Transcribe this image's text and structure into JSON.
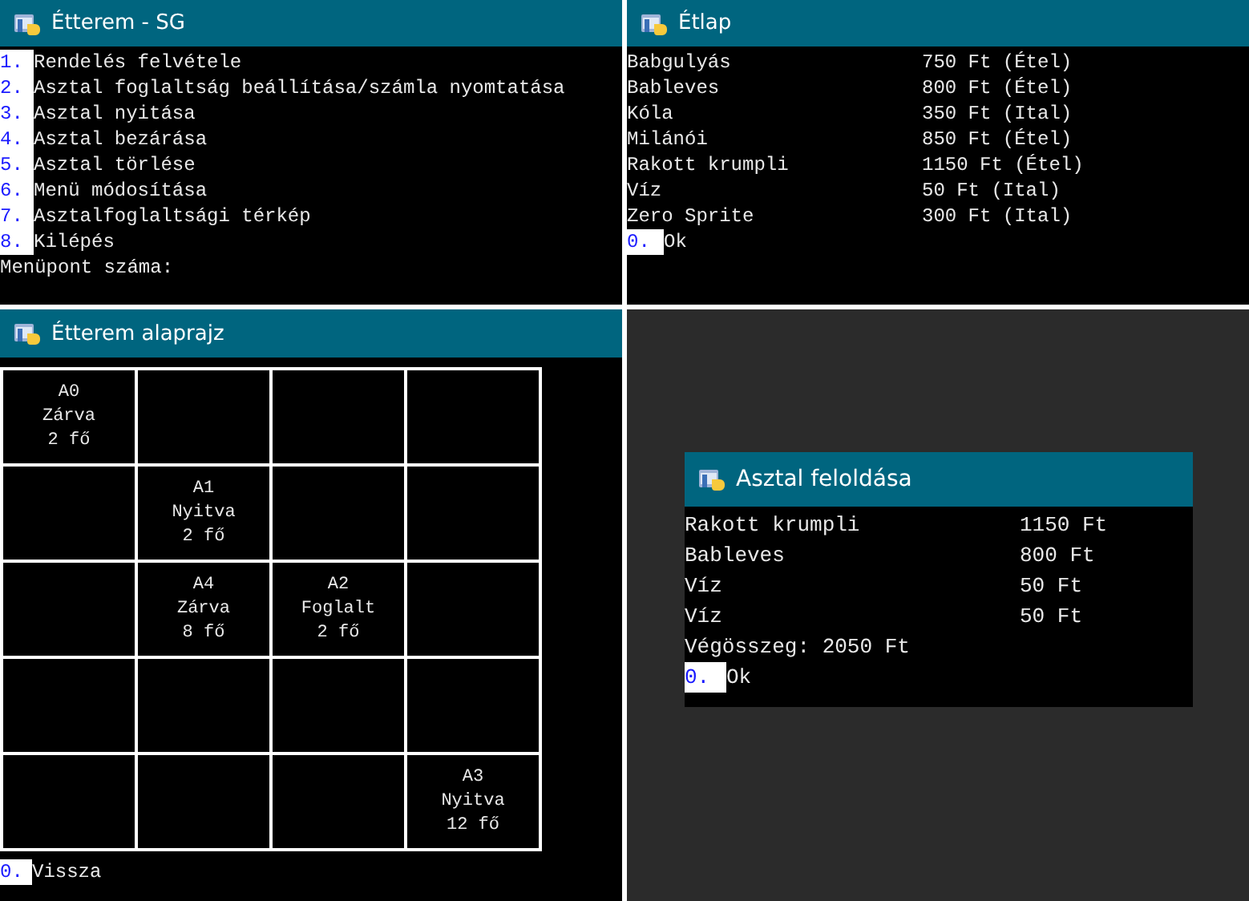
{
  "menu_window": {
    "title": "Étterem - SG",
    "items": [
      {
        "key": "1.",
        "label": "Rendelés felvétele"
      },
      {
        "key": "2.",
        "label": "Asztal foglaltság beállítása/számla nyomtatása"
      },
      {
        "key": "3.",
        "label": "Asztal nyitása"
      },
      {
        "key": "4.",
        "label": "Asztal bezárása"
      },
      {
        "key": "5.",
        "label": "Asztal törlése"
      },
      {
        "key": "6.",
        "label": "Menü módosítása"
      },
      {
        "key": "7.",
        "label": "Asztalfoglaltsági térkép"
      },
      {
        "key": "8.",
        "label": "Kilépés"
      }
    ],
    "prompt": "Menüpont száma:"
  },
  "menu_list_window": {
    "title": "Étlap",
    "rows": [
      {
        "name": "Babgulyás",
        "price": "750 Ft (Étel)"
      },
      {
        "name": "Bableves",
        "price": "800 Ft (Étel)"
      },
      {
        "name": "Kóla",
        "price": "350 Ft (Ital)"
      },
      {
        "name": "Milánói",
        "price": "850 Ft (Étel)"
      },
      {
        "name": "Rakott krumpli",
        "price": "1150 Ft (Étel)"
      },
      {
        "name": "Víz",
        "price": "50 Ft (Ital)"
      },
      {
        "name": "Zero Sprite",
        "price": "300 Ft (Ital)"
      }
    ],
    "action": {
      "key": "0.",
      "label": "Ok"
    }
  },
  "floor_plan_window": {
    "title": "Étterem alaprajz",
    "grid": [
      [
        {
          "kind": "table",
          "lines": [
            "A0",
            "Zárva",
            "2 fő"
          ]
        },
        {
          "kind": "empty"
        },
        {
          "kind": "empty"
        },
        {
          "kind": "empty"
        }
      ],
      [
        {
          "kind": "empty"
        },
        {
          "kind": "table",
          "lines": [
            "A1",
            "Nyitva",
            "2 fő"
          ]
        },
        {
          "kind": "empty"
        },
        {
          "kind": "empty"
        }
      ],
      [
        {
          "kind": "empty"
        },
        {
          "kind": "table",
          "lines": [
            "A4",
            "Zárva",
            "8 fő"
          ]
        },
        {
          "kind": "table",
          "lines": [
            "A2",
            "Foglalt",
            "2 fő"
          ]
        },
        {
          "kind": "empty"
        }
      ],
      [
        {
          "kind": "empty"
        },
        {
          "kind": "empty"
        },
        {
          "kind": "empty"
        },
        {
          "kind": "empty"
        }
      ],
      [
        {
          "kind": "empty"
        },
        {
          "kind": "empty"
        },
        {
          "kind": "empty"
        },
        {
          "kind": "table",
          "lines": [
            "A3",
            "Nyitva",
            "12 fő"
          ]
        }
      ]
    ],
    "action": {
      "key": "0.",
      "label": "Vissza"
    }
  },
  "bill_window": {
    "title": "Asztal feloldása",
    "rows": [
      {
        "name": "Rakott krumpli",
        "price": "1150 Ft"
      },
      {
        "name": "Bableves",
        "price": "800 Ft"
      },
      {
        "name": "Víz",
        "price": "50 Ft"
      },
      {
        "name": "Víz",
        "price": "50 Ft"
      }
    ],
    "total": "Végösszeg: 2050 Ft",
    "action": {
      "key": "0.",
      "label": "Ok"
    }
  }
}
